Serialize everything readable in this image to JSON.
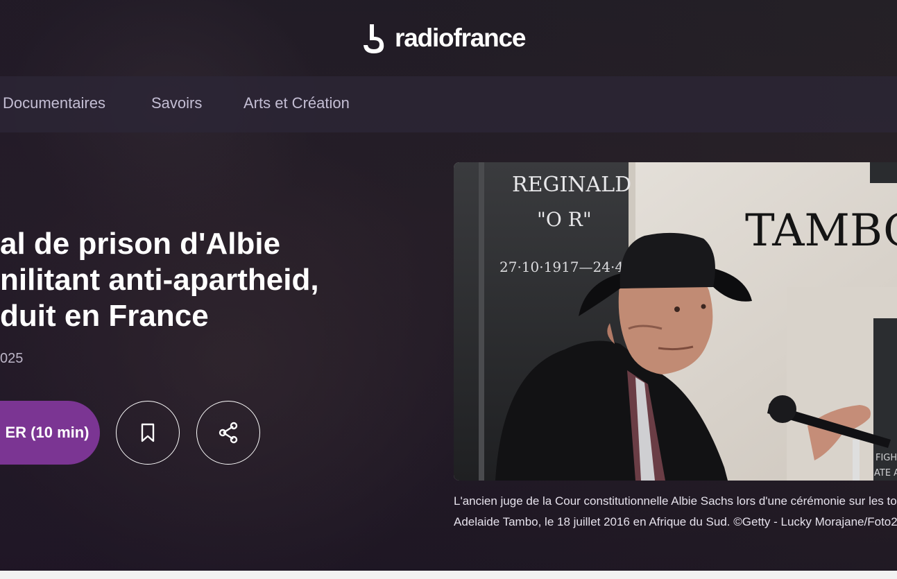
{
  "header": {
    "logo_text": "radiofrance"
  },
  "nav": {
    "items": [
      {
        "label": "Documentaires"
      },
      {
        "label": "Savoirs"
      },
      {
        "label": "Arts et Création"
      }
    ]
  },
  "hero": {
    "title_lines": [
      "al de prison d'Albie",
      "nilitant anti-apartheid,",
      "duit en France"
    ],
    "date": "025",
    "listen_label": "ER  (10 min)"
  },
  "photo": {
    "sign_texts": {
      "name": "REGINALD",
      "nick": "\"O R\"",
      "dates": "27·10·1917—24·4·",
      "wall": "TAMBO",
      "plaque": "FIGH",
      "plaque2": "ATE A"
    }
  },
  "caption": {
    "line1": "L'ancien juge de la Cour constitutionnelle Albie Sachs lors d'une cérémonie sur les tom",
    "line2": "Adelaide Tambo, le 18 juillet 2016 en Afrique du Sud. ©Getty - Lucky Morajane/Foto2"
  },
  "icons": {
    "bookmark": "bookmark-icon",
    "share": "share-icon",
    "logo": "radiofrance-logo-icon"
  },
  "colors": {
    "accent": "#7b3593",
    "nav_background": "#2c2636",
    "nav_text": "#c4bed4"
  }
}
